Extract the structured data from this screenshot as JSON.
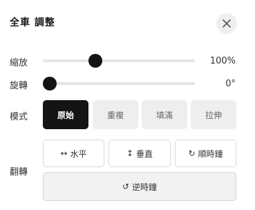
{
  "panel": {
    "title": "全車 調整",
    "close_icon": "close-icon"
  },
  "zoom": {
    "label": "縮放",
    "value_text": "100%",
    "level": 0.33
  },
  "rotate": {
    "label": "旋轉",
    "value_text": "0°",
    "level": 0.0
  },
  "mode": {
    "label": "模式",
    "options": [
      "原始",
      "重複",
      "填滿",
      "拉伸"
    ],
    "selected": "原始"
  },
  "flip": {
    "label": "翻轉",
    "horizontal": {
      "icon": "↔",
      "label": "水平"
    },
    "vertical": {
      "icon": "↕",
      "label": "垂直"
    },
    "clockwise": {
      "icon": "↻",
      "label": "順時鐘"
    },
    "counterclockwise": {
      "icon": "↺",
      "label": "逆時鐘"
    }
  },
  "colors": {
    "accent": "#141414",
    "button_bg": "#eeeeee",
    "track": "#e4e4e4"
  }
}
